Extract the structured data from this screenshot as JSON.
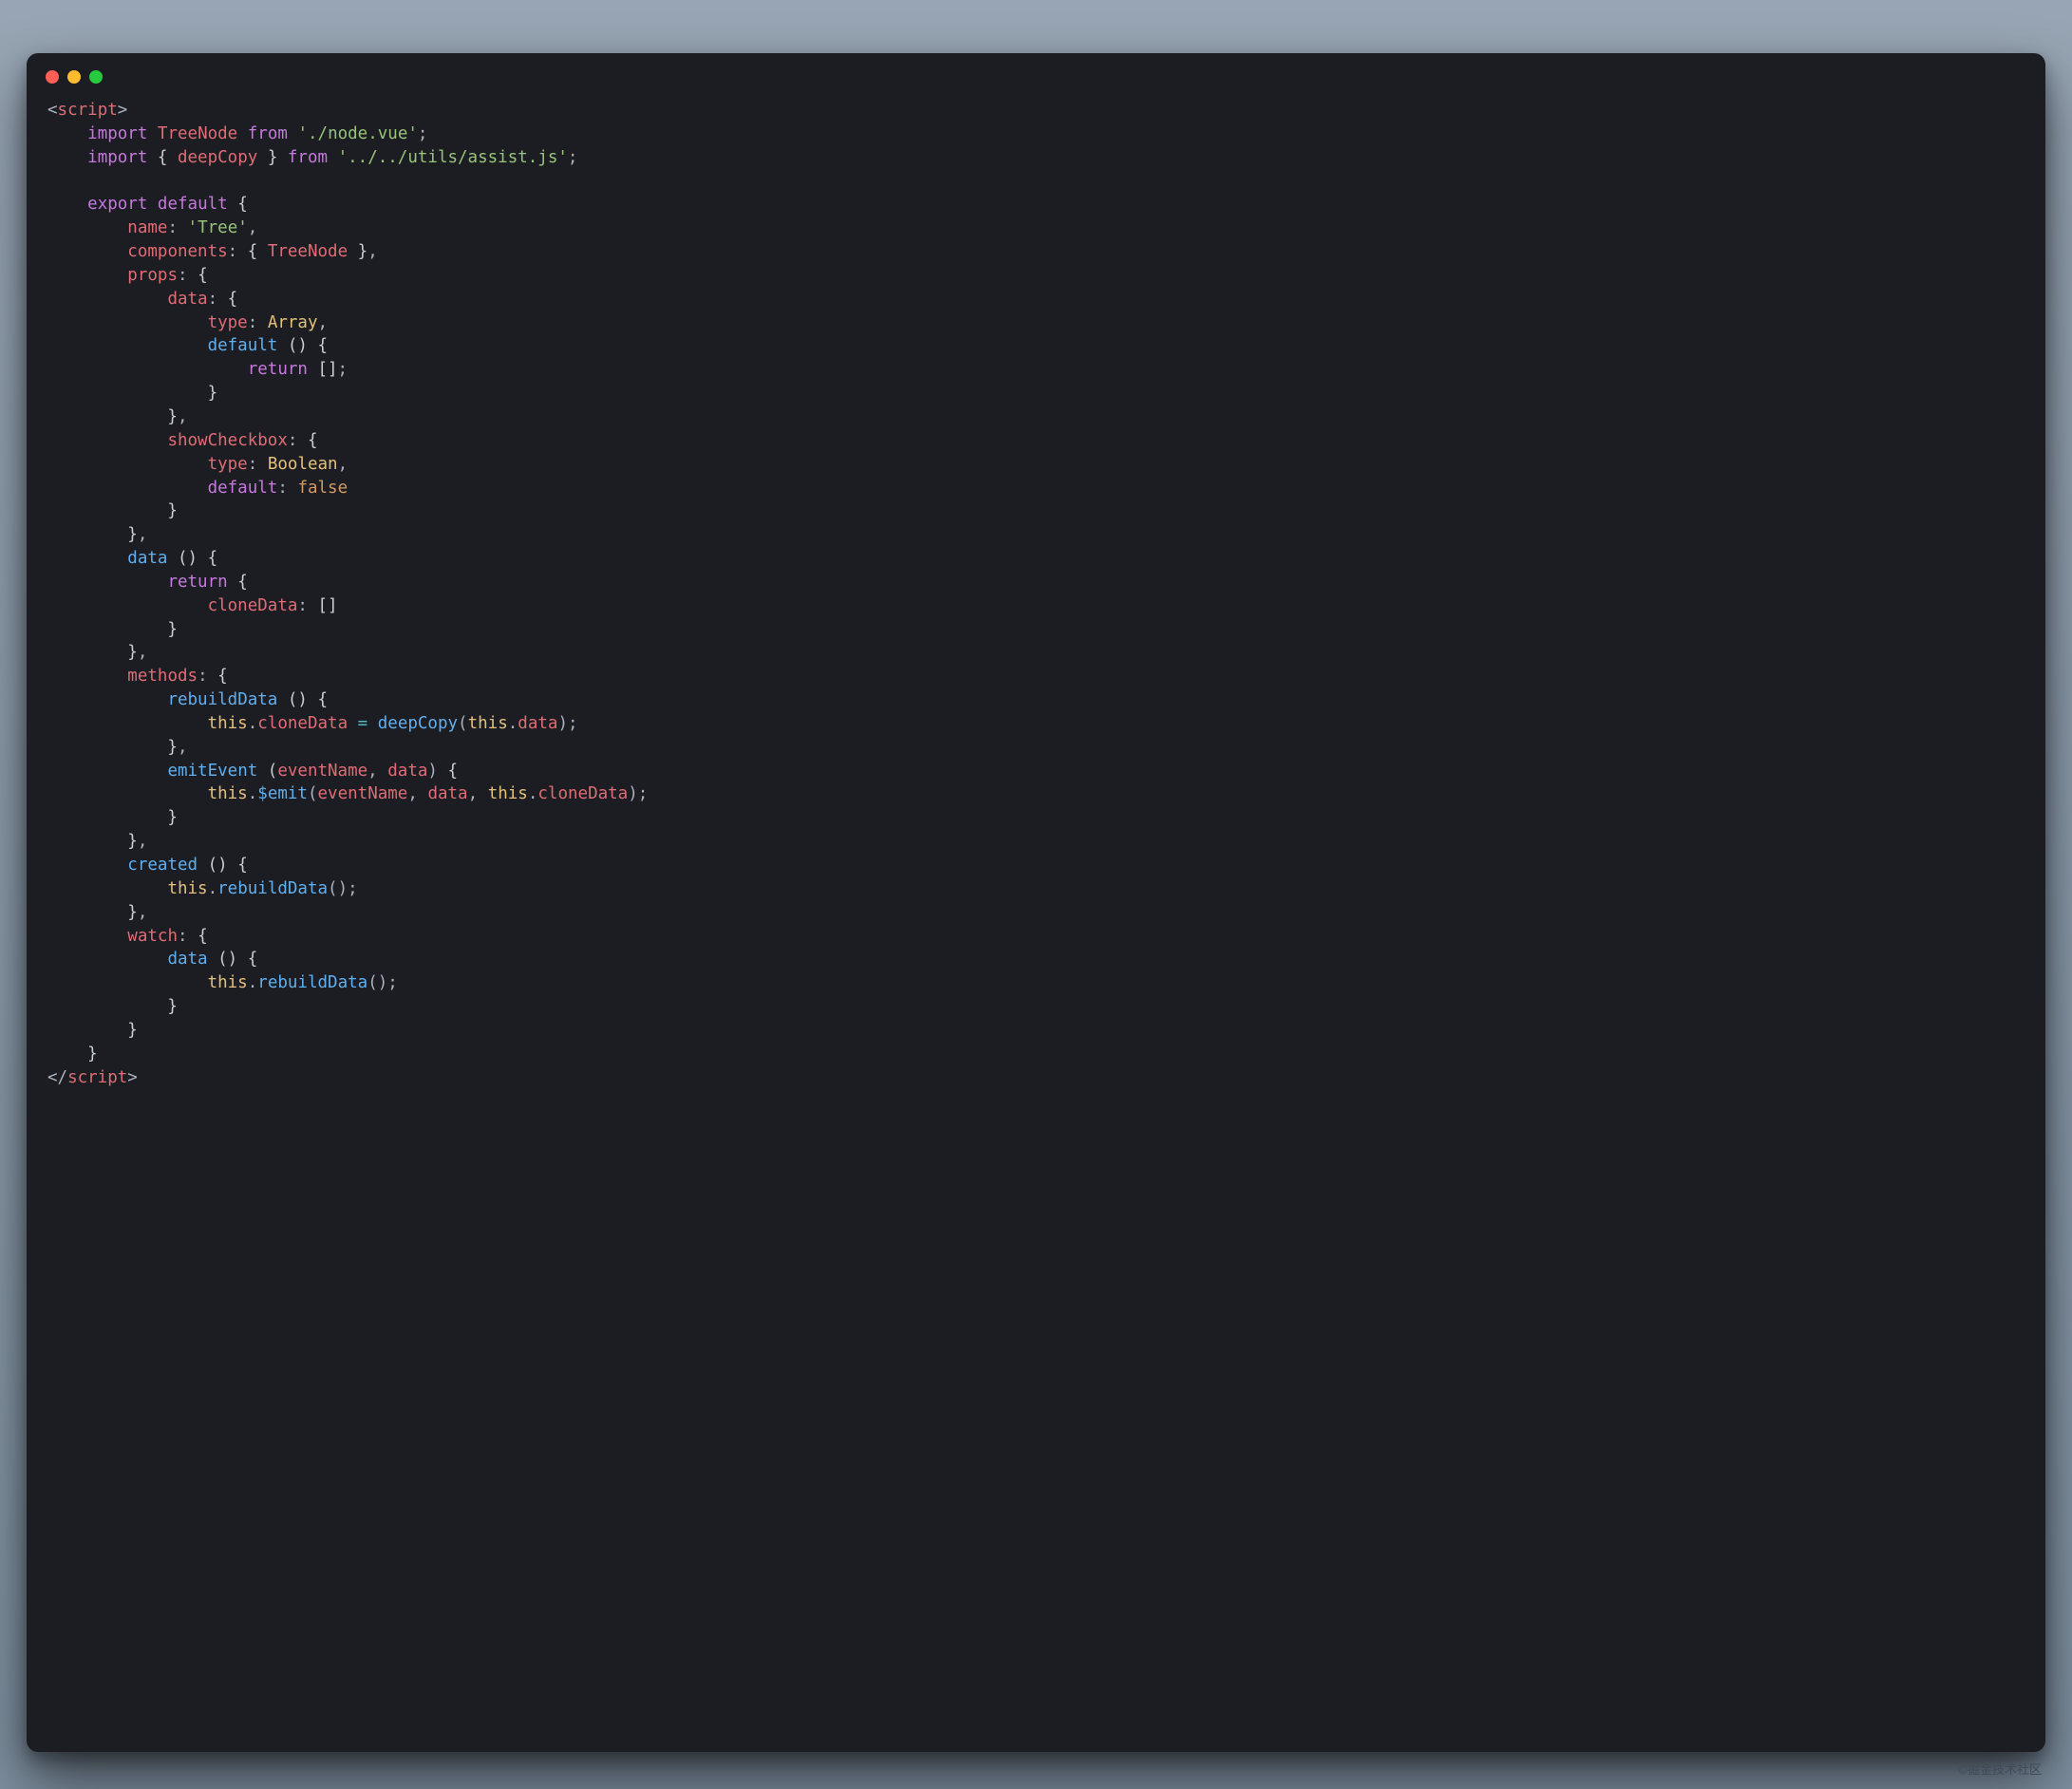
{
  "watermark": "©掘金技术社区",
  "traffic": {
    "red": "#ff5f56",
    "yellow": "#ffbd2e",
    "green": "#27c93f"
  },
  "colors": {
    "bg": "#1b1d22",
    "plain": "#c9cfd6",
    "keyword": "#c678dd",
    "string": "#98c379",
    "identifier": "#e06c75",
    "function": "#61afef",
    "constant": "#d19a66",
    "type": "#e5c07b",
    "operator": "#56b6c2"
  },
  "code": {
    "tokens": [
      [
        [
          "pn",
          "<"
        ],
        [
          "tag",
          "script"
        ],
        [
          "pn",
          ">"
        ]
      ],
      [
        [
          "pl",
          "    "
        ],
        [
          "kw",
          "import"
        ],
        [
          "pl",
          " "
        ],
        [
          "id",
          "TreeNode"
        ],
        [
          "pl",
          " "
        ],
        [
          "kw",
          "from"
        ],
        [
          "pl",
          " "
        ],
        [
          "str",
          "'./node.vue'"
        ],
        [
          "pn",
          ";"
        ]
      ],
      [
        [
          "pl",
          "    "
        ],
        [
          "kw",
          "import"
        ],
        [
          "pl",
          " { "
        ],
        [
          "id",
          "deepCopy"
        ],
        [
          "pl",
          " } "
        ],
        [
          "kw",
          "from"
        ],
        [
          "pl",
          " "
        ],
        [
          "str",
          "'../../utils/assist.js'"
        ],
        [
          "pn",
          ";"
        ]
      ],
      [
        [
          "pl",
          ""
        ]
      ],
      [
        [
          "pl",
          "    "
        ],
        [
          "kw",
          "export"
        ],
        [
          "pl",
          " "
        ],
        [
          "kw",
          "default"
        ],
        [
          "pl",
          " {"
        ]
      ],
      [
        [
          "pl",
          "        "
        ],
        [
          "prop",
          "name"
        ],
        [
          "pn",
          ":"
        ],
        [
          "pl",
          " "
        ],
        [
          "str",
          "'Tree'"
        ],
        [
          "pn",
          ","
        ]
      ],
      [
        [
          "pl",
          "        "
        ],
        [
          "prop",
          "components"
        ],
        [
          "pn",
          ":"
        ],
        [
          "pl",
          " { "
        ],
        [
          "id",
          "TreeNode"
        ],
        [
          "pl",
          " }"
        ],
        [
          "pn",
          ","
        ]
      ],
      [
        [
          "pl",
          "        "
        ],
        [
          "prop",
          "props"
        ],
        [
          "pn",
          ":"
        ],
        [
          "pl",
          " {"
        ]
      ],
      [
        [
          "pl",
          "            "
        ],
        [
          "prop",
          "data"
        ],
        [
          "pn",
          ":"
        ],
        [
          "pl",
          " {"
        ]
      ],
      [
        [
          "pl",
          "                "
        ],
        [
          "prop",
          "type"
        ],
        [
          "pn",
          ":"
        ],
        [
          "pl",
          " "
        ],
        [
          "typ",
          "Array"
        ],
        [
          "pn",
          ","
        ]
      ],
      [
        [
          "pl",
          "                "
        ],
        [
          "fn",
          "default"
        ],
        [
          "pl",
          " () {"
        ]
      ],
      [
        [
          "pl",
          "                    "
        ],
        [
          "kw",
          "return"
        ],
        [
          "pl",
          " []"
        ],
        [
          "pn",
          ";"
        ]
      ],
      [
        [
          "pl",
          "                }"
        ]
      ],
      [
        [
          "pl",
          "            }"
        ],
        [
          "pn",
          ","
        ]
      ],
      [
        [
          "pl",
          "            "
        ],
        [
          "prop",
          "showCheckbox"
        ],
        [
          "pn",
          ":"
        ],
        [
          "pl",
          " {"
        ]
      ],
      [
        [
          "pl",
          "                "
        ],
        [
          "prop",
          "type"
        ],
        [
          "pn",
          ":"
        ],
        [
          "pl",
          " "
        ],
        [
          "typ",
          "Boolean"
        ],
        [
          "pn",
          ","
        ]
      ],
      [
        [
          "pl",
          "                "
        ],
        [
          "kw",
          "default"
        ],
        [
          "pn",
          ":"
        ],
        [
          "pl",
          " "
        ],
        [
          "con",
          "false"
        ]
      ],
      [
        [
          "pl",
          "            }"
        ]
      ],
      [
        [
          "pl",
          "        }"
        ],
        [
          "pn",
          ","
        ]
      ],
      [
        [
          "pl",
          "        "
        ],
        [
          "fn",
          "data"
        ],
        [
          "pl",
          " () {"
        ]
      ],
      [
        [
          "pl",
          "            "
        ],
        [
          "kw",
          "return"
        ],
        [
          "pl",
          " {"
        ]
      ],
      [
        [
          "pl",
          "                "
        ],
        [
          "prop",
          "cloneData"
        ],
        [
          "pn",
          ":"
        ],
        [
          "pl",
          " []"
        ]
      ],
      [
        [
          "pl",
          "            }"
        ]
      ],
      [
        [
          "pl",
          "        }"
        ],
        [
          "pn",
          ","
        ]
      ],
      [
        [
          "pl",
          "        "
        ],
        [
          "prop",
          "methods"
        ],
        [
          "pn",
          ":"
        ],
        [
          "pl",
          " {"
        ]
      ],
      [
        [
          "pl",
          "            "
        ],
        [
          "fn",
          "rebuildData"
        ],
        [
          "pl",
          " () {"
        ]
      ],
      [
        [
          "pl",
          "                "
        ],
        [
          "thi",
          "this"
        ],
        [
          "pn",
          "."
        ],
        [
          "id",
          "cloneData"
        ],
        [
          "pl",
          " "
        ],
        [
          "op",
          "="
        ],
        [
          "pl",
          " "
        ],
        [
          "fn",
          "deepCopy"
        ],
        [
          "pn",
          "("
        ],
        [
          "thi",
          "this"
        ],
        [
          "pn",
          "."
        ],
        [
          "id",
          "data"
        ],
        [
          "pn",
          ");"
        ]
      ],
      [
        [
          "pl",
          "            }"
        ],
        [
          "pn",
          ","
        ]
      ],
      [
        [
          "pl",
          "            "
        ],
        [
          "fn",
          "emitEvent"
        ],
        [
          "pl",
          " ("
        ],
        [
          "id",
          "eventName"
        ],
        [
          "pn",
          ","
        ],
        [
          "pl",
          " "
        ],
        [
          "id",
          "data"
        ],
        [
          "pn",
          ")"
        ],
        [
          "pl",
          " {"
        ]
      ],
      [
        [
          "pl",
          "                "
        ],
        [
          "thi",
          "this"
        ],
        [
          "pn",
          "."
        ],
        [
          "fn",
          "$emit"
        ],
        [
          "pn",
          "("
        ],
        [
          "id",
          "eventName"
        ],
        [
          "pn",
          ","
        ],
        [
          "pl",
          " "
        ],
        [
          "id",
          "data"
        ],
        [
          "pn",
          ","
        ],
        [
          "pl",
          " "
        ],
        [
          "thi",
          "this"
        ],
        [
          "pn",
          "."
        ],
        [
          "id",
          "cloneData"
        ],
        [
          "pn",
          ");"
        ]
      ],
      [
        [
          "pl",
          "            }"
        ]
      ],
      [
        [
          "pl",
          "        }"
        ],
        [
          "pn",
          ","
        ]
      ],
      [
        [
          "pl",
          "        "
        ],
        [
          "fn",
          "created"
        ],
        [
          "pl",
          " () {"
        ]
      ],
      [
        [
          "pl",
          "            "
        ],
        [
          "thi",
          "this"
        ],
        [
          "pn",
          "."
        ],
        [
          "fn",
          "rebuildData"
        ],
        [
          "pn",
          "();"
        ]
      ],
      [
        [
          "pl",
          "        }"
        ],
        [
          "pn",
          ","
        ]
      ],
      [
        [
          "pl",
          "        "
        ],
        [
          "prop",
          "watch"
        ],
        [
          "pn",
          ":"
        ],
        [
          "pl",
          " {"
        ]
      ],
      [
        [
          "pl",
          "            "
        ],
        [
          "fn",
          "data"
        ],
        [
          "pl",
          " () {"
        ]
      ],
      [
        [
          "pl",
          "                "
        ],
        [
          "thi",
          "this"
        ],
        [
          "pn",
          "."
        ],
        [
          "fn",
          "rebuildData"
        ],
        [
          "pn",
          "();"
        ]
      ],
      [
        [
          "pl",
          "            }"
        ]
      ],
      [
        [
          "pl",
          "        }"
        ]
      ],
      [
        [
          "pl",
          "    }"
        ]
      ],
      [
        [
          "pn",
          "</"
        ],
        [
          "tag",
          "script"
        ],
        [
          "pn",
          ">"
        ]
      ]
    ]
  }
}
